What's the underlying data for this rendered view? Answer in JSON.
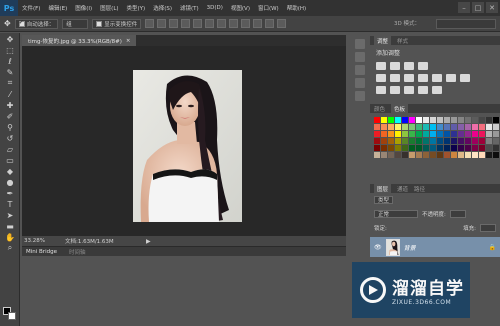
{
  "app": {
    "logo": "Ps",
    "menu": [
      "文件(F)",
      "编辑(E)",
      "图像(I)",
      "图层(L)",
      "类型(Y)",
      "选择(S)",
      "滤镜(T)",
      "3D(D)",
      "视图(V)",
      "窗口(W)",
      "帮助(H)"
    ],
    "window_controls": [
      "–",
      "□",
      "✕"
    ]
  },
  "options": {
    "auto_select_label": "自动选择：",
    "auto_select_value": "组",
    "show_transform_label": "显示变换控件",
    "mode_3d_label": "3D 模式："
  },
  "document": {
    "tab_title": "timg-恢复的.jpg @ 33.3%(RGB/8#)",
    "tab_close": "×",
    "zoom": "33.28%",
    "doc_size": "文档:1.63M/1.63M",
    "status_arrow": "▶"
  },
  "minibridge": {
    "tab_active": "Mini Bridge",
    "tab_inactive": "时间轴"
  },
  "adjustments": {
    "tabs": [
      "调整",
      "样式"
    ],
    "title": "添加调整"
  },
  "swatches_panel": {
    "tabs": [
      "颜色",
      "色板"
    ],
    "colors": [
      "#ff0000",
      "#ffff00",
      "#00ff00",
      "#00ffff",
      "#0000ff",
      "#ff00ff",
      "#ffffff",
      "#ebebeb",
      "#d6d6d6",
      "#c2c2c2",
      "#adadad",
      "#999999",
      "#858585",
      "#707070",
      "#5c5c5c",
      "#474747",
      "#333333",
      "#000000",
      "#f26c4f",
      "#f68e56",
      "#fbaf5d",
      "#fff467",
      "#acd373",
      "#7cc576",
      "#3bb878",
      "#1abbb4",
      "#00bff3",
      "#438ccb",
      "#5574b9",
      "#605ca8",
      "#855fa8",
      "#a763a8",
      "#f06eaa",
      "#f26d7d",
      "#e6e6e6",
      "#cccccc",
      "#ed1c24",
      "#f26522",
      "#f7941d",
      "#fff200",
      "#8dc63f",
      "#39b54a",
      "#00a651",
      "#00a99d",
      "#00aeef",
      "#0072bc",
      "#0054a6",
      "#2e3192",
      "#662d91",
      "#92278f",
      "#ec008c",
      "#ed145b",
      "#b3b3b3",
      "#999999",
      "#9e0b0f",
      "#a0410d",
      "#a36209",
      "#aba000",
      "#598527",
      "#1a7b30",
      "#007236",
      "#00746b",
      "#0076a3",
      "#004b80",
      "#003471",
      "#1b1464",
      "#440e62",
      "#630460",
      "#9e005d",
      "#9e0039",
      "#808080",
      "#666666",
      "#790000",
      "#7b2e00",
      "#7d4900",
      "#827b00",
      "#406618",
      "#005e20",
      "#005826",
      "#005952",
      "#005b7f",
      "#003663",
      "#002157",
      "#0d004c",
      "#32004b",
      "#4b0049",
      "#7b0046",
      "#7a0026",
      "#4d4d4d",
      "#333333",
      "#c7b299",
      "#998675",
      "#736357",
      "#534741",
      "#37302d",
      "#c69c6d",
      "#a67c52",
      "#8c6239",
      "#754c24",
      "#603913",
      "#a0522d",
      "#cd853f",
      "#deb887",
      "#f5deb3",
      "#ffe4c4",
      "#ffdab9",
      "#1a1a1a",
      "#0d0d0d"
    ]
  },
  "layers_panel": {
    "tabs": [
      "图层",
      "通道",
      "路径"
    ],
    "kind_label": "类型",
    "blend_mode": "正常",
    "opacity_label": "不透明度:",
    "lock_label": "锁定:",
    "fill_label": "填充:",
    "layer_name": "背景",
    "lock_icon": "🔒"
  },
  "watermark": {
    "title": "溜溜自学",
    "url": "ZIXUE.3D66.COM"
  }
}
